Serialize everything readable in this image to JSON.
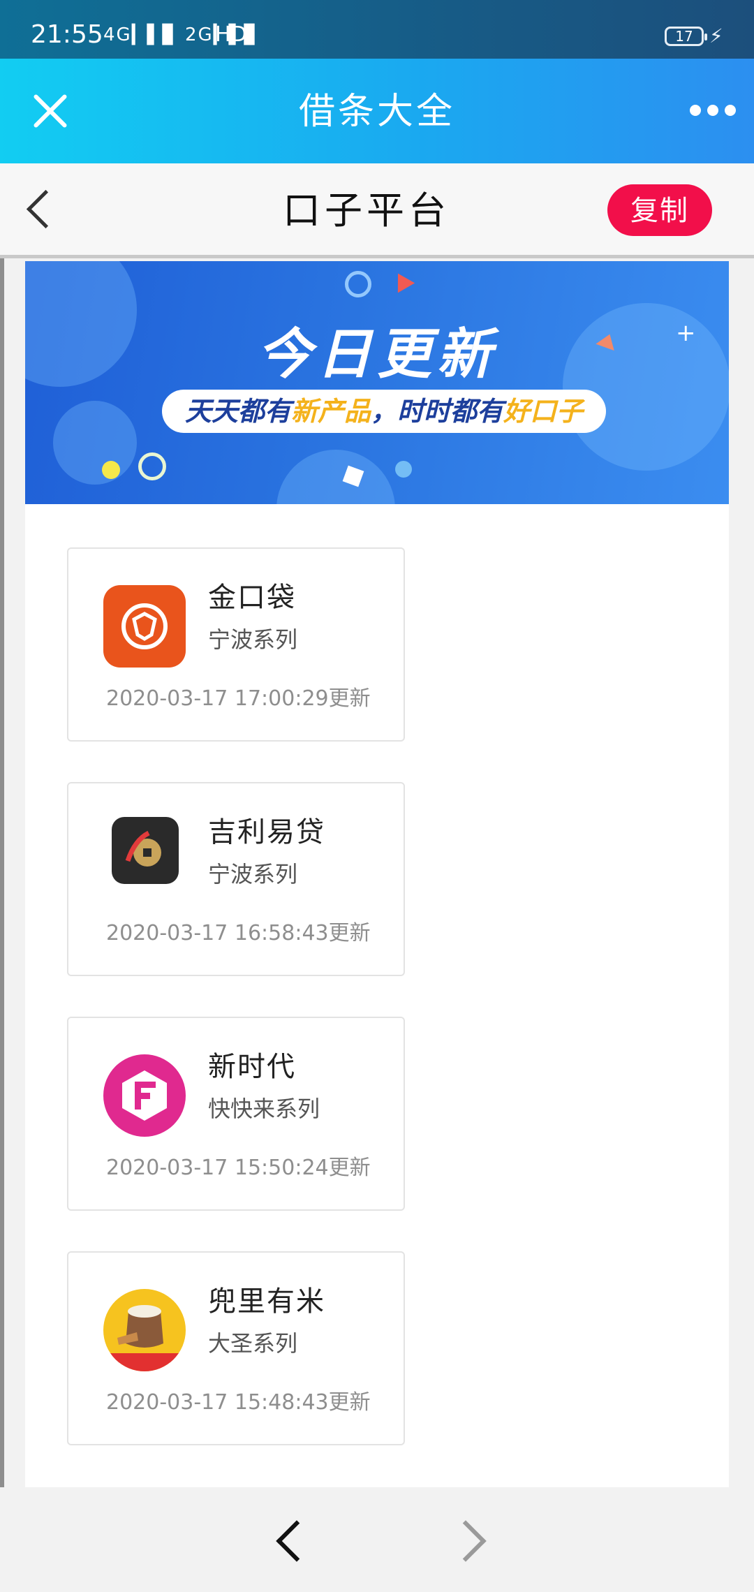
{
  "status_bar": {
    "time": "21:55",
    "signal": "4G▎▌▊ 2G▎▌▊",
    "network": "HD",
    "battery": "17"
  },
  "header": {
    "title": "借条大全"
  },
  "nav": {
    "title": "口子平台",
    "copy_label": "复制"
  },
  "banner": {
    "title": "今日更新",
    "subtitle_a": "天天都有",
    "subtitle_hl1": "新产品",
    "subtitle_b": "，时时都有",
    "subtitle_hl2": "好口子"
  },
  "cards": [
    {
      "name": "金口袋",
      "series": "宁波系列",
      "updated": "2020-03-17 17:00:29更新",
      "logo_icon": "shield-logo-icon",
      "color": "#e9541c"
    },
    {
      "name": "吉利易贷",
      "series": "宁波系列",
      "updated": "2020-03-17 16:58:43更新",
      "logo_icon": "coin-logo-icon",
      "color": "#2a2a2a"
    },
    {
      "name": "新时代",
      "series": "快快来系列",
      "updated": "2020-03-17 15:50:24更新",
      "logo_icon": "f-hexagon-logo-icon",
      "color": "#e0298f"
    },
    {
      "name": "兜里有米",
      "series": "大圣系列",
      "updated": "2020-03-17 15:48:43更新",
      "logo_icon": "rice-bag-logo-icon",
      "color": "#f6c31f"
    }
  ]
}
